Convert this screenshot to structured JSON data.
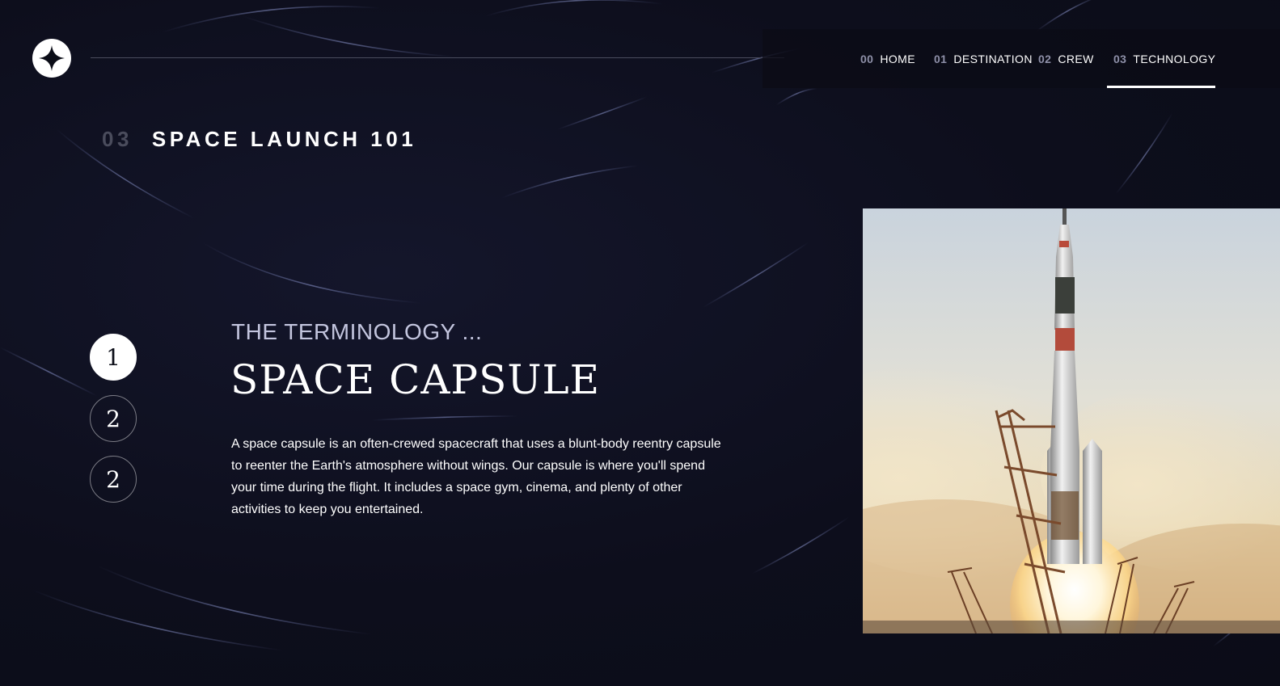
{
  "logo": {
    "icon": "star-logo-icon"
  },
  "nav": {
    "items": [
      {
        "num": "00",
        "label": "HOME"
      },
      {
        "num": "01",
        "label": "DESTINATION"
      },
      {
        "num": "02",
        "label": "CREW"
      },
      {
        "num": "03",
        "label": "TECHNOLOGY"
      }
    ],
    "active_index": 3
  },
  "page_heading": {
    "num": "03",
    "label": "SPACE LAUNCH 101"
  },
  "steps": [
    {
      "label": "1",
      "active": true
    },
    {
      "label": "2",
      "active": false
    },
    {
      "label": "2",
      "active": false
    }
  ],
  "content": {
    "label": "THE TERMINOLOGY ...",
    "title": "SPACE CAPSULE",
    "description": "A space capsule is an often-crewed spacecraft that uses a blunt-body reentry capsule to reenter the Earth's atmosphere without wings. Our capsule is where you'll spend your time during the flight. It includes a space gym, cinema, and plenty of other activities to keep you entertained."
  },
  "colors": {
    "background": "#0b0d17",
    "accent": "#ffffff",
    "muted": "#c3c5de"
  }
}
